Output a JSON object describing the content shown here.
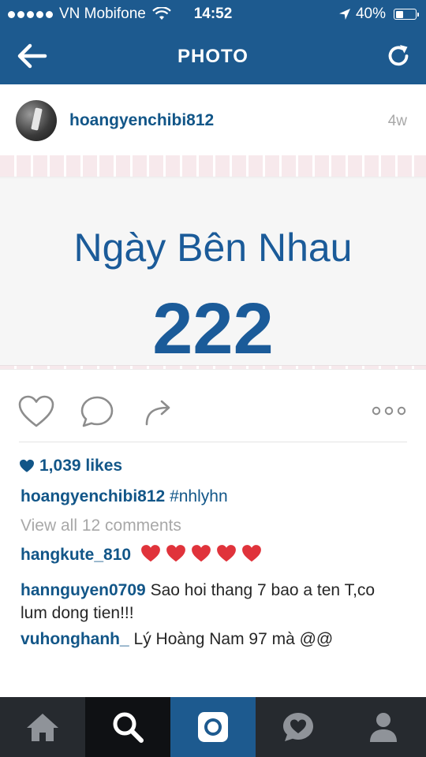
{
  "status_bar": {
    "carrier": "VN Mobifone",
    "time": "14:52",
    "battery_text": "40%",
    "battery_level": 0.4
  },
  "nav": {
    "title": "PHOTO",
    "back_icon": "back-arrow-icon",
    "refresh_icon": "refresh-icon"
  },
  "post": {
    "username": "hoangyenchibi812",
    "time": "4w",
    "photo": {
      "title": "Ngày Bên Nhau",
      "number": "222"
    },
    "likes": "1,039 likes",
    "caption": {
      "user": "hoangyenchibi812",
      "text": "#nhlyhn"
    },
    "view_all": "View all 12 comments",
    "comments": [
      {
        "user": "hangkute_810",
        "text": ""
      },
      {
        "user": "hannguyen0709",
        "text": "Sao hoi thang 7 bao a ten T,co lum dong tien!!!"
      },
      {
        "user": "vuhonghanh_",
        "text": "Lý Hoàng Nam 97 mà @@"
      }
    ]
  },
  "colors": {
    "header_bg": "#1d5a8f",
    "link_blue": "#125688",
    "heart_red": "#e0333b",
    "tabbar_bg": "#262a2f"
  },
  "tabs": [
    "home-icon",
    "search-icon",
    "camera-icon",
    "activity-heart-icon",
    "profile-icon"
  ]
}
